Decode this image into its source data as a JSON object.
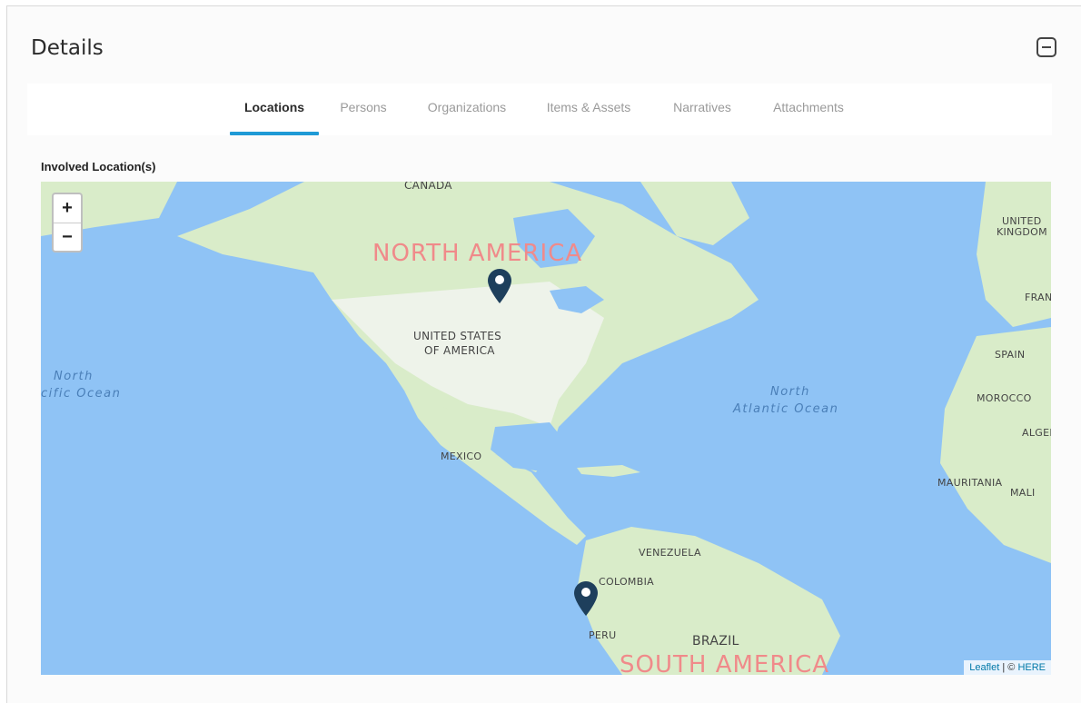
{
  "header": {
    "title": "Details"
  },
  "tabs": [
    {
      "label": "Locations",
      "active": true
    },
    {
      "label": "Persons",
      "active": false
    },
    {
      "label": "Organizations",
      "active": false
    },
    {
      "label": "Items & Assets",
      "active": false
    },
    {
      "label": "Narratives",
      "active": false
    },
    {
      "label": "Attachments",
      "active": false
    }
  ],
  "section": {
    "label": "Involved Location(s)"
  },
  "map": {
    "zoom_in": "+",
    "zoom_out": "−",
    "labels": {
      "canada": "CANADA",
      "north_america": "NORTH AMERICA",
      "usa_line1": "UNITED STATES",
      "usa_line2": "OF AMERICA",
      "mexico": "MEXICO",
      "venezuela": "VENEZUELA",
      "colombia": "COLOMBIA",
      "peru": "PERU",
      "brazil": "BRAZIL",
      "south_america": "SOUTH AMERICA",
      "north_pacific_line1": "North",
      "north_pacific_line2": "cific Ocean",
      "north_atlantic_line1": "North",
      "north_atlantic_line2": "Atlantic Ocean",
      "uk_line1": "UNITED",
      "uk_line2": "KINGDOM",
      "france": "FRAN",
      "spain": "SPAIN",
      "morocco": "MOROCCO",
      "algeria": "ALGEF",
      "mauritania": "MAURITANIA",
      "mali": "MALI"
    },
    "attribution": {
      "leaflet": "Leaflet",
      "separator": " | © ",
      "here": "HERE"
    },
    "colors": {
      "water": "#8fc3f5",
      "land": "#d9ecc9",
      "urban": "#f2f2ee",
      "marker": "#1e3f5c",
      "continent_label": "#f08a8a"
    }
  }
}
